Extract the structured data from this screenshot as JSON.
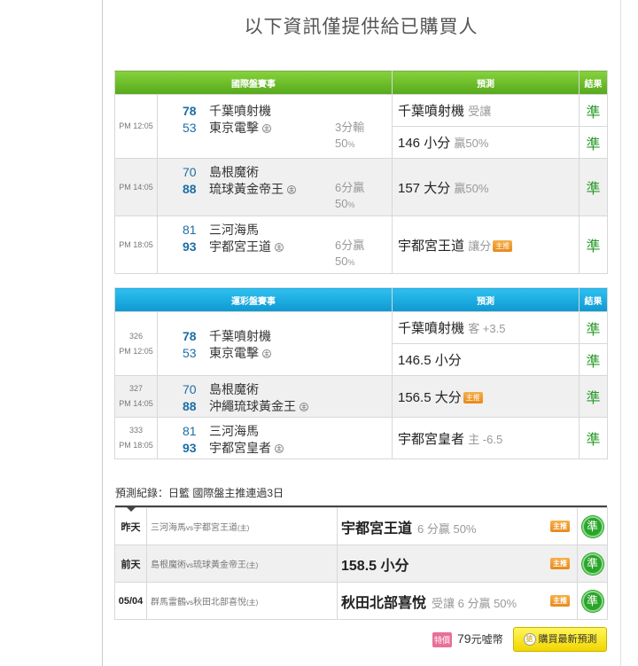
{
  "heading": "以下資訊僅提供給已購買人",
  "intl": {
    "header": {
      "event": "國際盤賽事",
      "prediction": "預測",
      "result": "結果"
    },
    "games": [
      {
        "time": "PM 12:05",
        "away": {
          "score": "78",
          "team": "千葉噴射機"
        },
        "home": {
          "score": "53",
          "team": "東京電擊"
        },
        "result_line1": "3分輸",
        "result_pct": "50",
        "preds": [
          {
            "main": "千葉噴射機",
            "sub": "受讓",
            "result": "準"
          },
          {
            "main": "146 小分",
            "sub": "贏50%",
            "result": "準"
          }
        ]
      },
      {
        "time": "PM 14:05",
        "away": {
          "score": "70",
          "team": "島根魔術"
        },
        "home": {
          "score": "88",
          "team": "琉球黃金帝王"
        },
        "result_line1": "6分贏",
        "result_pct": "50",
        "preds": [
          {
            "main": "157 大分",
            "sub": "贏50%",
            "result": "準"
          }
        ]
      },
      {
        "time": "PM 18:05",
        "away": {
          "score": "81",
          "team": "三河海馬"
        },
        "home": {
          "score": "93",
          "team": "宇都宮王道"
        },
        "result_line1": "6分贏",
        "result_pct": "50",
        "preds": [
          {
            "main": "宇都宮王道",
            "sub": "讓分",
            "badge": "主推",
            "result": "準"
          }
        ]
      }
    ]
  },
  "lottery": {
    "header": {
      "event": "運彩盤賽事",
      "prediction": "預測",
      "result": "結果"
    },
    "games": [
      {
        "no": "326",
        "time": "PM 12:05",
        "away": {
          "score": "78",
          "team": "千葉噴射機"
        },
        "home": {
          "score": "53",
          "team": "東京電擊"
        },
        "preds": [
          {
            "main": "千葉噴射機",
            "sub": "客 +3.5",
            "result": "準"
          },
          {
            "main": "146.5 小分",
            "sub": "",
            "result": "準"
          }
        ]
      },
      {
        "no": "327",
        "time": "PM 14:05",
        "away": {
          "score": "70",
          "team": "島根魔術"
        },
        "home": {
          "score": "88",
          "team": "沖繩琉球黃金王"
        },
        "preds": [
          {
            "main": "156.5 大分",
            "sub": "",
            "badge": "主推",
            "result": "準"
          }
        ]
      },
      {
        "no": "333",
        "time": "PM 18:05",
        "away": {
          "score": "81",
          "team": "三河海馬"
        },
        "home": {
          "score": "93",
          "team": "宇都宮皇者"
        },
        "preds": [
          {
            "main": "宇都宮皇者",
            "sub": "主 -6.5",
            "result": "準"
          }
        ]
      }
    ]
  },
  "home_mark": "主",
  "pct_sign": "%",
  "record": {
    "title": "預測紀錄：日籃 國際盤主推連過3日",
    "rows": [
      {
        "day": "昨天",
        "away": "三河海馬",
        "vs": "vs",
        "home": "宇都宮王道",
        "home_mark": "(主)",
        "pred": "宇都宮王道",
        "sub": "6 分贏 50%",
        "badge": "主推",
        "result": "準"
      },
      {
        "day": "前天",
        "away": "島根魔術",
        "vs": "vs",
        "home": "琉球黃金帝王",
        "home_mark": "(主)",
        "pred": "158.5 小分",
        "sub": "",
        "badge": "主推",
        "result": "準"
      },
      {
        "day": "05/04",
        "away": "群馬雷鶴",
        "vs": "vs",
        "home": "秋田北部喜悅",
        "home_mark": "(主)",
        "pred": "秋田北部喜悅",
        "sub": "受讓 6 分贏 50%",
        "badge": "主推",
        "result": "準"
      }
    ]
  },
  "footer": {
    "price_tag": "特價",
    "price": "79",
    "price_unit": "元噓幣",
    "buy_icon": "搶",
    "buy_label": "購買最新預測"
  }
}
